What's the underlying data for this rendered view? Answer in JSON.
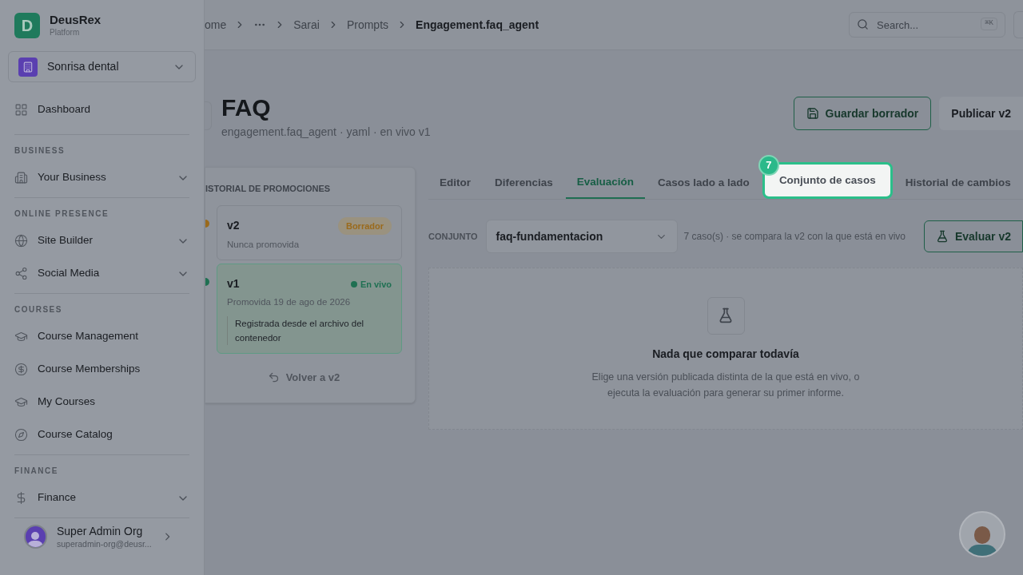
{
  "sidebar": {
    "brand": {
      "logo_letter": "D",
      "name": "DeusRex",
      "subtitle": "Platform"
    },
    "workspace": "Sonrisa dental",
    "sections": [
      {
        "items": [
          {
            "label": "Dashboard",
            "expandable": false
          }
        ]
      },
      {
        "heading": "BUSINESS",
        "items": [
          {
            "label": "Your Business",
            "expandable": true
          }
        ]
      },
      {
        "heading": "ONLINE PRESENCE",
        "items": [
          {
            "label": "Site Builder",
            "expandable": true
          },
          {
            "label": "Social Media",
            "expandable": true
          }
        ]
      },
      {
        "heading": "COURSES",
        "items": [
          {
            "label": "Course Management",
            "expandable": false
          },
          {
            "label": "Course Memberships",
            "expandable": false
          },
          {
            "label": "My Courses",
            "expandable": false
          },
          {
            "label": "Course Catalog",
            "expandable": false
          }
        ]
      },
      {
        "heading": "FINANCE",
        "items": [
          {
            "label": "Finance",
            "expandable": true
          }
        ]
      }
    ],
    "user": {
      "name": "Super Admin Org",
      "email": "superadmin-org@deusr..."
    }
  },
  "header": {
    "breadcrumb": [
      {
        "kind": "link",
        "label": "ome"
      },
      {
        "kind": "ellipsis"
      },
      {
        "kind": "link",
        "label": "Sarai"
      },
      {
        "kind": "link",
        "label": "Prompts"
      },
      {
        "kind": "current",
        "label": "Engagement.faq_agent"
      }
    ],
    "search": {
      "placeholder": "Search...",
      "shortcut": "⌘K"
    }
  },
  "page": {
    "title": "FAQ",
    "subtitle": "engagement.faq_agent · yaml · en vivo v1",
    "actions": [
      {
        "kind": "outline",
        "label": "Guardar borrador"
      },
      {
        "kind": "plain",
        "label": "Publicar v2"
      }
    ]
  },
  "history": {
    "heading": "ISTORIAL DE PROMOCIONES",
    "versions": [
      {
        "version": "v2",
        "kind": "draft",
        "status": "Borrador",
        "subtitle": "Nunca promovida",
        "selected": false,
        "color": "#9a6a1c"
      },
      {
        "version": "v1",
        "kind": "live",
        "status": "En vivo",
        "subtitle": "Promovida 19 de ago de 2026",
        "note": "Registrada desde el archivo del contenedor",
        "selected": true,
        "color": "#1f7052"
      }
    ],
    "revert": "Volver a v2"
  },
  "tabs": [
    {
      "label": "Editor",
      "selected": false,
      "highlighted": false
    },
    {
      "label": "Diferencias",
      "selected": false,
      "highlighted": false
    },
    {
      "label": "Evaluación",
      "selected": true,
      "highlighted": false
    },
    {
      "label": "Casos lado a lado",
      "selected": false,
      "highlighted": false
    },
    {
      "label": "Conjunto de casos",
      "selected": false,
      "highlighted": true,
      "tour_step": "7"
    },
    {
      "label": "Historial de cambios",
      "selected": false,
      "highlighted": false
    }
  ],
  "evaluation": {
    "set_label": "CONJUNTO",
    "set_value": "faq-fundamentacion",
    "summary": "7 caso(s) · se compara la v2 con la que está en vivo",
    "run_button": "Evaluar v2",
    "empty": {
      "title": "Nada que comparar todavía",
      "body": "Elige una versión publicada distinta de la que está en vivo, o ejecuta la evaluación para generar su primer informe."
    }
  }
}
